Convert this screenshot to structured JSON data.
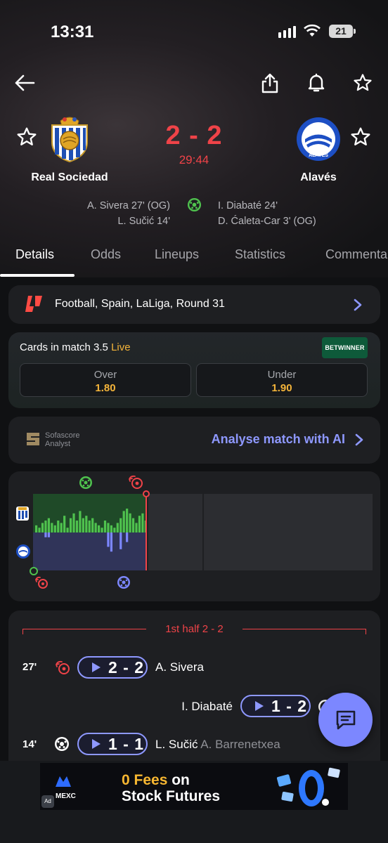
{
  "status_bar": {
    "time": "13:31",
    "battery": "21"
  },
  "header": {
    "back_icon": "arrow-left-icon",
    "share_icon": "share-icon",
    "bell_icon": "bell-icon",
    "favorite_icon": "star-icon"
  },
  "match": {
    "home": {
      "name": "Real Sociedad",
      "scorers": [
        "A. Sivera 27' (OG)",
        "L. Sučić 14'"
      ]
    },
    "away": {
      "name": "Alavés",
      "scorers": [
        "I. Diabaté 24'",
        "D. Ćaleta-Car 3' (OG)"
      ]
    },
    "score": "2 - 2",
    "clock": "29:44"
  },
  "tabs": [
    "Details",
    "Odds",
    "Lineups",
    "Statistics",
    "Commentary"
  ],
  "league": {
    "text": "Football, Spain, LaLiga, Round 31"
  },
  "odds": {
    "title": "Cards in match 3.5",
    "live": "Live",
    "provider": "BETWINNER",
    "over": {
      "label": "Over",
      "value": "1.80"
    },
    "under": {
      "label": "Under",
      "value": "1.90"
    }
  },
  "ai": {
    "brand_line1": "Sofascore",
    "brand_line2": "Analyst",
    "link": "Analyse match with AI"
  },
  "colors": {
    "accent": "#8e98ff",
    "score_red": "#ef4348",
    "odds_gold": "#f4b43a",
    "home_bar": "#4fc24e",
    "away_bar": "#7c87ff"
  },
  "momentum": {
    "home": [
      3,
      2,
      4,
      5,
      6,
      4,
      3,
      5,
      4,
      7,
      2,
      6,
      8,
      5,
      9,
      6,
      7,
      5,
      6,
      4,
      3,
      2,
      5,
      4,
      3,
      2,
      4,
      6,
      9,
      10,
      8,
      6,
      4,
      7,
      8,
      5
    ],
    "away": [
      0,
      0,
      0,
      2,
      2,
      0,
      0,
      0,
      0,
      0,
      0,
      0,
      0,
      0,
      0,
      0,
      0,
      0,
      0,
      0,
      0,
      0,
      0,
      6,
      8,
      0,
      0,
      7,
      0,
      4,
      0,
      0,
      0,
      0,
      0,
      0
    ],
    "progress": 0.321
  },
  "events": {
    "half_label": "1st half 2 - 2",
    "rows": [
      {
        "minute": "27'",
        "score": "2 - 2",
        "player": "A. Sivera",
        "assist": ""
      },
      {
        "minute": "",
        "score": "1 - 2",
        "player": "I. Diabaté",
        "assist": ""
      },
      {
        "minute": "14'",
        "score": "1 - 1",
        "player": "L. Sučić",
        "assist": "A. Barrenetxea"
      }
    ]
  },
  "ad": {
    "brand": "MEXC",
    "line1_highlight": "0 Fees",
    "line1_rest": " on",
    "line2": "Stock Futures"
  }
}
